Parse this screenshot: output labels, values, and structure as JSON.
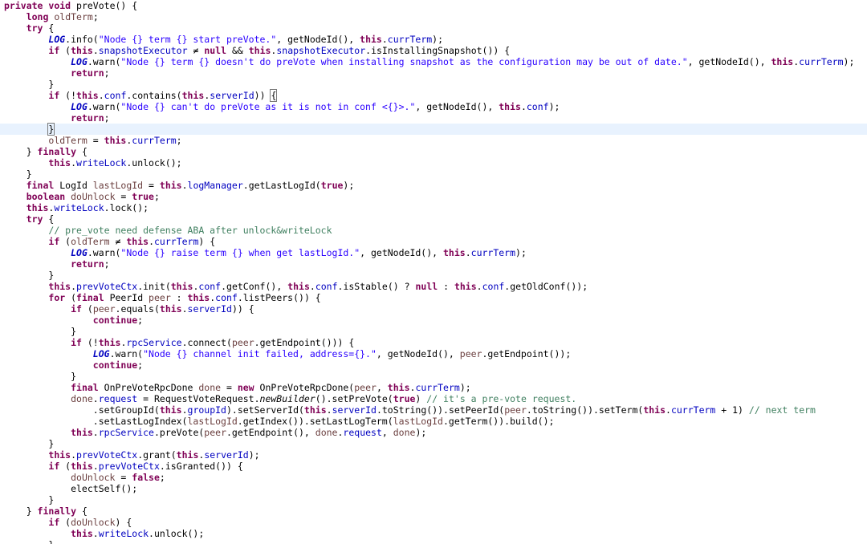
{
  "editor": {
    "language": "Java",
    "current_line": 12,
    "lines": [
      [
        [
          "k",
          "private"
        ],
        [
          "t",
          " "
        ],
        [
          "k",
          "void"
        ],
        [
          "t",
          " preVote() {"
        ]
      ],
      [
        [
          "t",
          "    "
        ],
        [
          "k",
          "long"
        ],
        [
          "t",
          " "
        ],
        [
          "l",
          "oldTerm"
        ],
        [
          "t",
          ";"
        ]
      ],
      [
        [
          "t",
          "    "
        ],
        [
          "k",
          "try"
        ],
        [
          "t",
          " {"
        ]
      ],
      [
        [
          "t",
          "        "
        ],
        [
          "s",
          "LOG"
        ],
        [
          "t",
          ".info("
        ],
        [
          "q",
          "\"Node {} term {} start preVote.\""
        ],
        [
          "t",
          ", getNodeId(), "
        ],
        [
          "k",
          "this"
        ],
        [
          "t",
          "."
        ],
        [
          "f",
          "currTerm"
        ],
        [
          "t",
          ");"
        ]
      ],
      [
        [
          "t",
          "        "
        ],
        [
          "k",
          "if"
        ],
        [
          "t",
          " ("
        ],
        [
          "k",
          "this"
        ],
        [
          "t",
          "."
        ],
        [
          "f",
          "snapshotExecutor"
        ],
        [
          "t",
          " ≠ "
        ],
        [
          "k",
          "null"
        ],
        [
          "t",
          " && "
        ],
        [
          "k",
          "this"
        ],
        [
          "t",
          "."
        ],
        [
          "f",
          "snapshotExecutor"
        ],
        [
          "t",
          ".isInstallingSnapshot()) {"
        ]
      ],
      [
        [
          "t",
          "            "
        ],
        [
          "s",
          "LOG"
        ],
        [
          "t",
          ".warn("
        ],
        [
          "q",
          "\"Node {} term {} doesn't do preVote when installing snapshot as the configuration may be out of date.\""
        ],
        [
          "t",
          ", getNodeId(), "
        ],
        [
          "k",
          "this"
        ],
        [
          "t",
          "."
        ],
        [
          "f",
          "currTerm"
        ],
        [
          "t",
          ");"
        ]
      ],
      [
        [
          "t",
          "            "
        ],
        [
          "k",
          "return"
        ],
        [
          "t",
          ";"
        ]
      ],
      [
        [
          "t",
          "        }"
        ]
      ],
      [
        [
          "t",
          "        "
        ],
        [
          "k",
          "if"
        ],
        [
          "t",
          " (!"
        ],
        [
          "k",
          "this"
        ],
        [
          "t",
          "."
        ],
        [
          "f",
          "conf"
        ],
        [
          "t",
          ".contains("
        ],
        [
          "k",
          "this"
        ],
        [
          "t",
          "."
        ],
        [
          "f",
          "serverId"
        ],
        [
          "t",
          ")) "
        ],
        [
          "b",
          "{"
        ]
      ],
      [
        [
          "t",
          "            "
        ],
        [
          "s",
          "LOG"
        ],
        [
          "t",
          ".warn("
        ],
        [
          "q",
          "\"Node {} can't do preVote as it is not in conf <{}>.\""
        ],
        [
          "t",
          ", getNodeId(), "
        ],
        [
          "k",
          "this"
        ],
        [
          "t",
          "."
        ],
        [
          "f",
          "conf"
        ],
        [
          "t",
          ");"
        ]
      ],
      [
        [
          "t",
          "            "
        ],
        [
          "k",
          "return"
        ],
        [
          "t",
          ";"
        ]
      ],
      [
        [
          "t",
          "        "
        ],
        [
          "b",
          "}"
        ]
      ],
      [
        [
          "t",
          "        "
        ],
        [
          "l",
          "oldTerm"
        ],
        [
          "t",
          " = "
        ],
        [
          "k",
          "this"
        ],
        [
          "t",
          "."
        ],
        [
          "f",
          "currTerm"
        ],
        [
          "t",
          ";"
        ]
      ],
      [
        [
          "t",
          "    } "
        ],
        [
          "k",
          "finally"
        ],
        [
          "t",
          " {"
        ]
      ],
      [
        [
          "t",
          "        "
        ],
        [
          "k",
          "this"
        ],
        [
          "t",
          "."
        ],
        [
          "f",
          "writeLock"
        ],
        [
          "t",
          ".unlock();"
        ]
      ],
      [
        [
          "t",
          "    }"
        ]
      ],
      [
        [
          "t",
          "    "
        ],
        [
          "k",
          "final"
        ],
        [
          "t",
          " LogId "
        ],
        [
          "l",
          "lastLogId"
        ],
        [
          "t",
          " = "
        ],
        [
          "k",
          "this"
        ],
        [
          "t",
          "."
        ],
        [
          "f",
          "logManager"
        ],
        [
          "t",
          ".getLastLogId("
        ],
        [
          "k",
          "true"
        ],
        [
          "t",
          ");"
        ]
      ],
      [
        [
          "t",
          "    "
        ],
        [
          "k",
          "boolean"
        ],
        [
          "t",
          " "
        ],
        [
          "l",
          "doUnlock"
        ],
        [
          "t",
          " = "
        ],
        [
          "k",
          "true"
        ],
        [
          "t",
          ";"
        ]
      ],
      [
        [
          "t",
          "    "
        ],
        [
          "k",
          "this"
        ],
        [
          "t",
          "."
        ],
        [
          "f",
          "writeLock"
        ],
        [
          "t",
          ".lock();"
        ]
      ],
      [
        [
          "t",
          "    "
        ],
        [
          "k",
          "try"
        ],
        [
          "t",
          " {"
        ]
      ],
      [
        [
          "t",
          "        "
        ],
        [
          "c",
          "// pre_vote need defense ABA after unlock&writeLock"
        ]
      ],
      [
        [
          "t",
          "        "
        ],
        [
          "k",
          "if"
        ],
        [
          "t",
          " ("
        ],
        [
          "l",
          "oldTerm"
        ],
        [
          "t",
          " ≠ "
        ],
        [
          "k",
          "this"
        ],
        [
          "t",
          "."
        ],
        [
          "f",
          "currTerm"
        ],
        [
          "t",
          ") {"
        ]
      ],
      [
        [
          "t",
          "            "
        ],
        [
          "s",
          "LOG"
        ],
        [
          "t",
          ".warn("
        ],
        [
          "q",
          "\"Node {} raise term {} when get lastLogId.\""
        ],
        [
          "t",
          ", getNodeId(), "
        ],
        [
          "k",
          "this"
        ],
        [
          "t",
          "."
        ],
        [
          "f",
          "currTerm"
        ],
        [
          "t",
          ");"
        ]
      ],
      [
        [
          "t",
          "            "
        ],
        [
          "k",
          "return"
        ],
        [
          "t",
          ";"
        ]
      ],
      [
        [
          "t",
          "        }"
        ]
      ],
      [
        [
          "t",
          "        "
        ],
        [
          "k",
          "this"
        ],
        [
          "t",
          "."
        ],
        [
          "f",
          "prevVoteCtx"
        ],
        [
          "t",
          ".init("
        ],
        [
          "k",
          "this"
        ],
        [
          "t",
          "."
        ],
        [
          "f",
          "conf"
        ],
        [
          "t",
          ".getConf(), "
        ],
        [
          "k",
          "this"
        ],
        [
          "t",
          "."
        ],
        [
          "f",
          "conf"
        ],
        [
          "t",
          ".isStable() ? "
        ],
        [
          "k",
          "null"
        ],
        [
          "t",
          " : "
        ],
        [
          "k",
          "this"
        ],
        [
          "t",
          "."
        ],
        [
          "f",
          "conf"
        ],
        [
          "t",
          ".getOldConf());"
        ]
      ],
      [
        [
          "t",
          "        "
        ],
        [
          "k",
          "for"
        ],
        [
          "t",
          " ("
        ],
        [
          "k",
          "final"
        ],
        [
          "t",
          " PeerId "
        ],
        [
          "l",
          "peer"
        ],
        [
          "t",
          " : "
        ],
        [
          "k",
          "this"
        ],
        [
          "t",
          "."
        ],
        [
          "f",
          "conf"
        ],
        [
          "t",
          ".listPeers()) {"
        ]
      ],
      [
        [
          "t",
          "            "
        ],
        [
          "k",
          "if"
        ],
        [
          "t",
          " ("
        ],
        [
          "l",
          "peer"
        ],
        [
          "t",
          ".equals("
        ],
        [
          "k",
          "this"
        ],
        [
          "t",
          "."
        ],
        [
          "f",
          "serverId"
        ],
        [
          "t",
          ")) {"
        ]
      ],
      [
        [
          "t",
          "                "
        ],
        [
          "k",
          "continue"
        ],
        [
          "t",
          ";"
        ]
      ],
      [
        [
          "t",
          "            }"
        ]
      ],
      [
        [
          "t",
          "            "
        ],
        [
          "k",
          "if"
        ],
        [
          "t",
          " (!"
        ],
        [
          "k",
          "this"
        ],
        [
          "t",
          "."
        ],
        [
          "f",
          "rpcService"
        ],
        [
          "t",
          ".connect("
        ],
        [
          "l",
          "peer"
        ],
        [
          "t",
          ".getEndpoint())) {"
        ]
      ],
      [
        [
          "t",
          "                "
        ],
        [
          "s",
          "LOG"
        ],
        [
          "t",
          ".warn("
        ],
        [
          "q",
          "\"Node {} channel init failed, address={}.\""
        ],
        [
          "t",
          ", getNodeId(), "
        ],
        [
          "l",
          "peer"
        ],
        [
          "t",
          ".getEndpoint());"
        ]
      ],
      [
        [
          "t",
          "                "
        ],
        [
          "k",
          "continue"
        ],
        [
          "t",
          ";"
        ]
      ],
      [
        [
          "t",
          "            }"
        ]
      ],
      [
        [
          "t",
          "            "
        ],
        [
          "k",
          "final"
        ],
        [
          "t",
          " OnPreVoteRpcDone "
        ],
        [
          "l",
          "done"
        ],
        [
          "t",
          " = "
        ],
        [
          "k",
          "new"
        ],
        [
          "t",
          " OnPreVoteRpcDone("
        ],
        [
          "l",
          "peer"
        ],
        [
          "t",
          ", "
        ],
        [
          "k",
          "this"
        ],
        [
          "t",
          "."
        ],
        [
          "f",
          "currTerm"
        ],
        [
          "t",
          ");"
        ]
      ],
      [
        [
          "t",
          "            "
        ],
        [
          "l",
          "done"
        ],
        [
          "t",
          "."
        ],
        [
          "f",
          "request"
        ],
        [
          "t",
          " = RequestVoteRequest."
        ],
        [
          "i",
          "newBuilder"
        ],
        [
          "t",
          "().setPreVote("
        ],
        [
          "k",
          "true"
        ],
        [
          "t",
          ") "
        ],
        [
          "c",
          "// it's a pre-vote request."
        ]
      ],
      [
        [
          "t",
          "                .setGroupId("
        ],
        [
          "k",
          "this"
        ],
        [
          "t",
          "."
        ],
        [
          "f",
          "groupId"
        ],
        [
          "t",
          ").setServerId("
        ],
        [
          "k",
          "this"
        ],
        [
          "t",
          "."
        ],
        [
          "f",
          "serverId"
        ],
        [
          "t",
          ".toString()).setPeerId("
        ],
        [
          "l",
          "peer"
        ],
        [
          "t",
          ".toString()).setTerm("
        ],
        [
          "k",
          "this"
        ],
        [
          "t",
          "."
        ],
        [
          "f",
          "currTerm"
        ],
        [
          "t",
          " + 1) "
        ],
        [
          "c",
          "// next term"
        ]
      ],
      [
        [
          "t",
          "                .setLastLogIndex("
        ],
        [
          "l",
          "lastLogId"
        ],
        [
          "t",
          ".getIndex()).setLastLogTerm("
        ],
        [
          "l",
          "lastLogId"
        ],
        [
          "t",
          ".getTerm()).build();"
        ]
      ],
      [
        [
          "t",
          "            "
        ],
        [
          "k",
          "this"
        ],
        [
          "t",
          "."
        ],
        [
          "f",
          "rpcService"
        ],
        [
          "t",
          ".preVote("
        ],
        [
          "l",
          "peer"
        ],
        [
          "t",
          ".getEndpoint(), "
        ],
        [
          "l",
          "done"
        ],
        [
          "t",
          "."
        ],
        [
          "f",
          "request"
        ],
        [
          "t",
          ", "
        ],
        [
          "l",
          "done"
        ],
        [
          "t",
          ");"
        ]
      ],
      [
        [
          "t",
          "        }"
        ]
      ],
      [
        [
          "t",
          "        "
        ],
        [
          "k",
          "this"
        ],
        [
          "t",
          "."
        ],
        [
          "f",
          "prevVoteCtx"
        ],
        [
          "t",
          ".grant("
        ],
        [
          "k",
          "this"
        ],
        [
          "t",
          "."
        ],
        [
          "f",
          "serverId"
        ],
        [
          "t",
          ");"
        ]
      ],
      [
        [
          "t",
          "        "
        ],
        [
          "k",
          "if"
        ],
        [
          "t",
          " ("
        ],
        [
          "k",
          "this"
        ],
        [
          "t",
          "."
        ],
        [
          "f",
          "prevVoteCtx"
        ],
        [
          "t",
          ".isGranted()) {"
        ]
      ],
      [
        [
          "t",
          "            "
        ],
        [
          "l",
          "doUnlock"
        ],
        [
          "t",
          " = "
        ],
        [
          "k",
          "false"
        ],
        [
          "t",
          ";"
        ]
      ],
      [
        [
          "t",
          "            electSelf();"
        ]
      ],
      [
        [
          "t",
          "        }"
        ]
      ],
      [
        [
          "t",
          "    } "
        ],
        [
          "k",
          "finally"
        ],
        [
          "t",
          " {"
        ]
      ],
      [
        [
          "t",
          "        "
        ],
        [
          "k",
          "if"
        ],
        [
          "t",
          " ("
        ],
        [
          "l",
          "doUnlock"
        ],
        [
          "t",
          ") {"
        ]
      ],
      [
        [
          "t",
          "            "
        ],
        [
          "k",
          "this"
        ],
        [
          "t",
          "."
        ],
        [
          "f",
          "writeLock"
        ],
        [
          "t",
          ".unlock();"
        ]
      ],
      [
        [
          "t",
          "        }"
        ]
      ]
    ]
  }
}
